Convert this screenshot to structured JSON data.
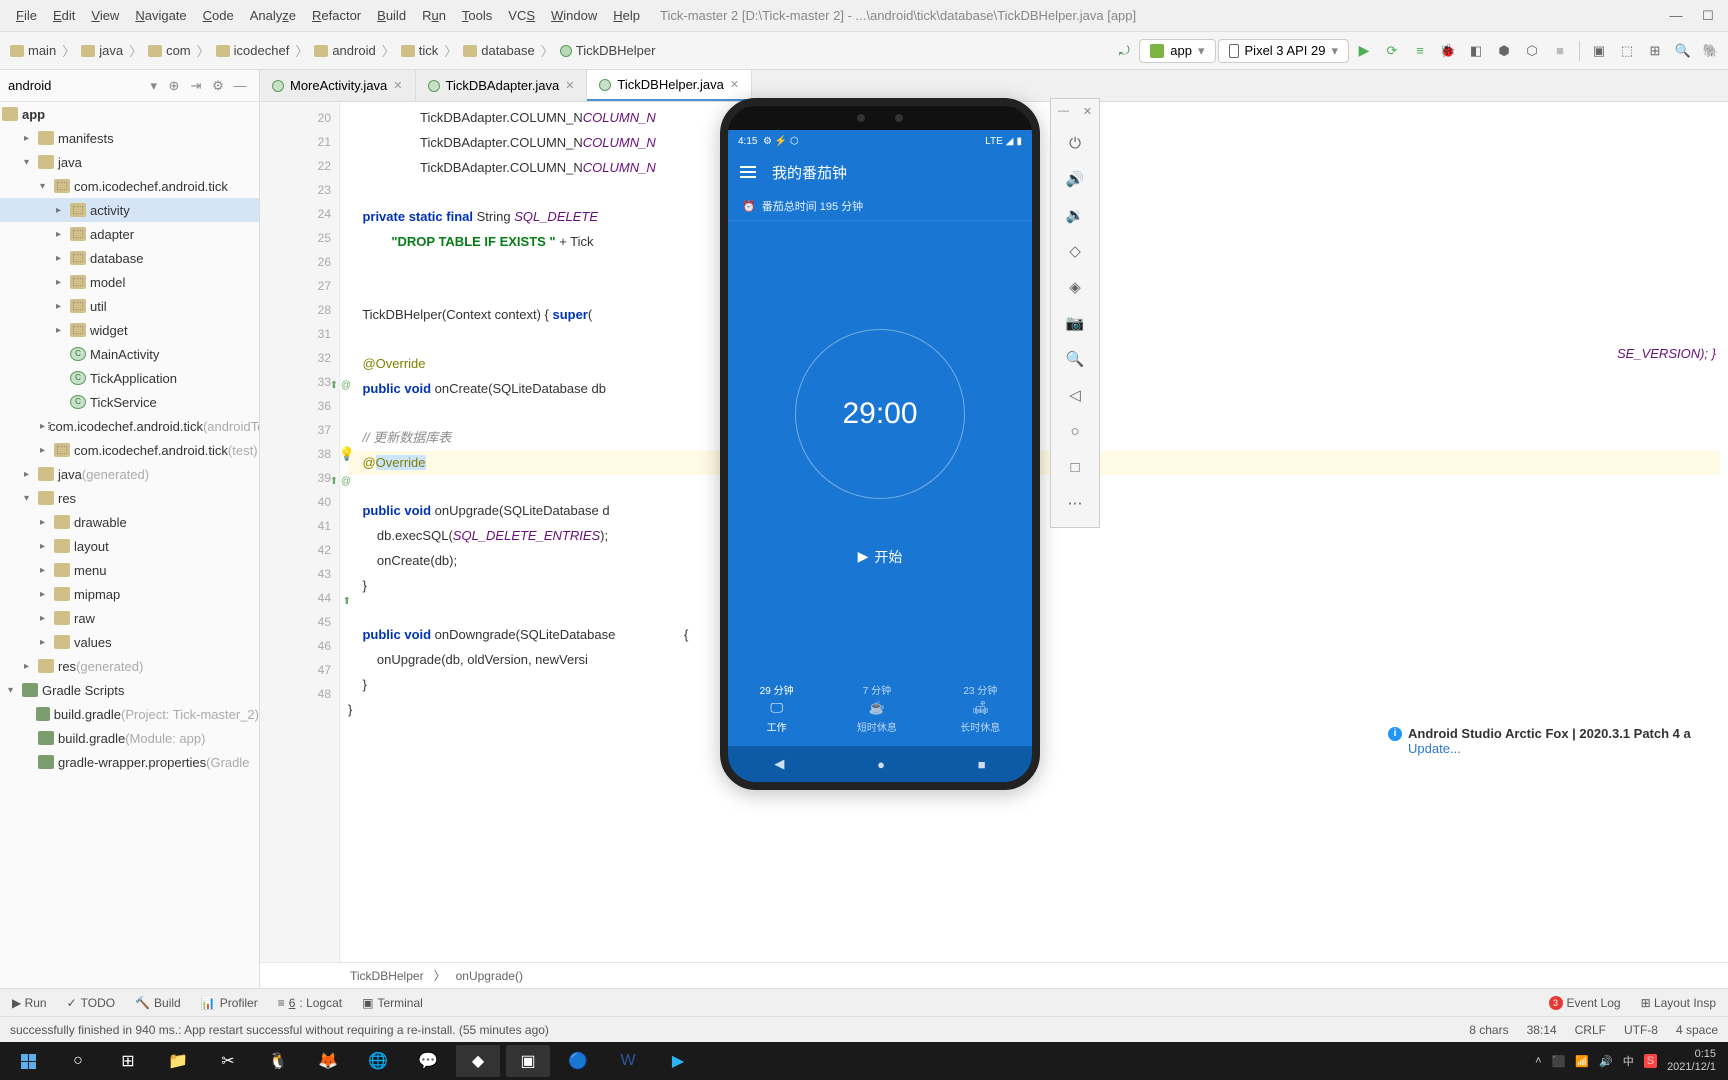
{
  "menubar": {
    "file": "File",
    "edit": "Edit",
    "view": "View",
    "navigate": "Navigate",
    "code": "Code",
    "analyze": "Analyze",
    "refactor": "Refactor",
    "build": "Build",
    "run": "Run",
    "tools": "Tools",
    "vcs": "VCS",
    "window": "Window",
    "help": "Help",
    "title": "Tick-master 2 [D:\\Tick-master 2] - ...\\android\\tick\\database\\TickDBHelper.java [app]"
  },
  "breadcrumbs": [
    "main",
    "java",
    "com",
    "icodechef",
    "android",
    "tick",
    "database",
    "TickDBHelper"
  ],
  "run_config": "app",
  "device": "Pixel 3 API 29",
  "project": {
    "label": "android",
    "root": "app",
    "tree": [
      {
        "l": 0,
        "name": "manifests",
        "icon": "folder",
        "chev": "▸"
      },
      {
        "l": 0,
        "name": "java",
        "icon": "folder",
        "chev": "▾"
      },
      {
        "l": 1,
        "name": "com.icodechef.android.tick",
        "icon": "pkg",
        "chev": "▾"
      },
      {
        "l": 2,
        "name": "activity",
        "icon": "pkg",
        "chev": "▸",
        "sel": true
      },
      {
        "l": 2,
        "name": "adapter",
        "icon": "pkg",
        "chev": "▸"
      },
      {
        "l": 2,
        "name": "database",
        "icon": "pkg",
        "chev": "▸"
      },
      {
        "l": 2,
        "name": "model",
        "icon": "pkg",
        "chev": "▸"
      },
      {
        "l": 2,
        "name": "util",
        "icon": "pkg",
        "chev": "▸"
      },
      {
        "l": 2,
        "name": "widget",
        "icon": "pkg",
        "chev": "▸"
      },
      {
        "l": 2,
        "name": "MainActivity",
        "icon": "class"
      },
      {
        "l": 2,
        "name": "TickApplication",
        "icon": "class"
      },
      {
        "l": 2,
        "name": "TickService",
        "icon": "class"
      },
      {
        "l": 1,
        "name": "com.icodechef.android.tick",
        "suffix": " (androidTest)",
        "icon": "pkg",
        "chev": "▸"
      },
      {
        "l": 1,
        "name": "com.icodechef.android.tick",
        "suffix": " (test)",
        "icon": "pkg",
        "chev": "▸"
      },
      {
        "l": 0,
        "name": "java",
        "suffix": " (generated)",
        "icon": "folder",
        "chev": "▸"
      },
      {
        "l": 0,
        "name": "res",
        "icon": "folder",
        "chev": "▾"
      },
      {
        "l": 1,
        "name": "drawable",
        "icon": "res",
        "chev": "▸"
      },
      {
        "l": 1,
        "name": "layout",
        "icon": "res",
        "chev": "▸"
      },
      {
        "l": 1,
        "name": "menu",
        "icon": "res",
        "chev": "▸"
      },
      {
        "l": 1,
        "name": "mipmap",
        "icon": "res",
        "chev": "▸"
      },
      {
        "l": 1,
        "name": "raw",
        "icon": "res",
        "chev": "▸"
      },
      {
        "l": 1,
        "name": "values",
        "icon": "res",
        "chev": "▸"
      },
      {
        "l": 0,
        "name": "res",
        "suffix": " (generated)",
        "icon": "res",
        "chev": "▸"
      },
      {
        "l": -1,
        "name": "Gradle Scripts",
        "icon": "gradle",
        "chev": "▾"
      },
      {
        "l": 0,
        "name": "build.gradle",
        "suffix": " (Project: Tick-master_2)",
        "icon": "gradle"
      },
      {
        "l": 0,
        "name": "build.gradle",
        "suffix": " (Module: app)",
        "icon": "gradle"
      },
      {
        "l": 0,
        "name": "gradle-wrapper.properties",
        "suffix": " (Gradle",
        "icon": "gradle"
      }
    ]
  },
  "tabs": [
    {
      "name": "MoreActivity.java",
      "active": false
    },
    {
      "name": "TickDBAdapter.java",
      "active": false
    },
    {
      "name": "TickDBHelper.java",
      "active": true
    }
  ],
  "line_numbers": [
    20,
    21,
    22,
    23,
    24,
    25,
    26,
    27,
    28,
    31,
    32,
    33,
    36,
    37,
    38,
    39,
    40,
    41,
    42,
    43,
    44,
    45,
    46,
    47,
    48
  ],
  "code": {
    "l20": "                    TickDBAdapter.COLUMN_N",
    "l21": "                    TickDBAdapter.COLUMN_N",
    "l22": "                    TickDBAdapter.COLUMN_N",
    "l24a": "    private static final ",
    "l24b": "String ",
    "l24c": "SQL_DELETE",
    "l25a": "            \"DROP TABLE IF EXISTS \"",
    "l25b": " + Tick",
    "l28a": "    TickDBHelper(Context context) { ",
    "l28b": "super",
    "l28c": "(",
    "l32": "    @Override",
    "l33a": "    public void ",
    "l33b": "onCreate(SQLiteDatabase db",
    "l37": "    // 更新数据库表",
    "l38a": "    @",
    "l38b": "Override",
    "l39a": "    public void ",
    "l39b": "onUpgrade(SQLiteDatabase d",
    "l40a": "        db.execSQL(",
    "l40b": "SQL_DELETE_ENTRIES",
    "l40c": ");",
    "l41": "        onCreate(db);",
    "l42": "    }",
    "l44a": "    public void ",
    "l44b": "onDowngrade(SQLiteDatabase",
    "l44c": "                   {",
    "l45": "        onUpgrade(db, oldVersion, newVersi",
    "l46": "    }",
    "l47": "}",
    "right_frag": "SE_VERSION); }"
  },
  "editor_crumb": {
    "class": "TickDBHelper",
    "method": "onUpgrade()"
  },
  "emulator": {
    "status_time": "4:15",
    "status_net": "LTE",
    "app_title": "我的番茄钟",
    "subtitle": "番茄总时间 195 分钟",
    "timer": "29:00",
    "start": "开始",
    "nav": [
      {
        "time": "29 分钟",
        "label": "工作",
        "icon": "🖵"
      },
      {
        "time": "7 分钟",
        "label": "短时休息",
        "icon": "☕"
      },
      {
        "time": "23 分钟",
        "label": "长时休息",
        "icon": "🛋"
      }
    ]
  },
  "notification": {
    "title": "Android Studio Arctic Fox | 2020.3.1 Patch 4 a",
    "link": "Update..."
  },
  "toolwin": [
    {
      "label": "Run"
    },
    {
      "label": "TODO",
      "icon": "✓"
    },
    {
      "label": "Build",
      "icon": "🔨"
    },
    {
      "label": "Profiler",
      "icon": "📊"
    },
    {
      "label": "6: Logcat",
      "icon": "≡",
      "u": "6"
    },
    {
      "label": "Terminal",
      "icon": "▣"
    }
  ],
  "toolwin_right": [
    {
      "label": "Event Log",
      "badge": "3"
    },
    {
      "label": "Layout Insp"
    }
  ],
  "status": {
    "msg": "successfully finished in 940 ms.: App restart successful without requiring a re-install. (55 minutes ago)",
    "chars": "8 chars",
    "pos": "38:14",
    "eol": "CRLF",
    "enc": "UTF-8",
    "indent": "4 space"
  },
  "tray": {
    "time": "0:15",
    "date": "2021/12/1",
    "ime": "中"
  }
}
